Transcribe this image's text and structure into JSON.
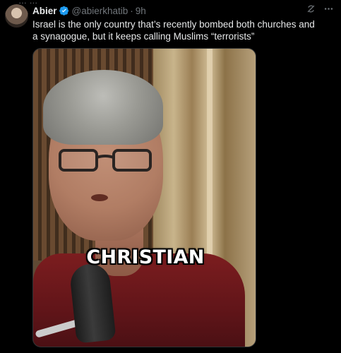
{
  "tweet": {
    "author_name": "Abier",
    "handle": "@abierkhatib",
    "separator": "·",
    "time": "9h",
    "text": "Israel is the only country that’s recently bombed both churches and a synagogue, but it keeps calling Muslims “terrorists”"
  },
  "media": {
    "caption": "CHRISTIAN"
  },
  "icons": {
    "verified": "verified-badge-icon",
    "grok": "grok-icon",
    "more": "more-icon"
  },
  "colors": {
    "background": "#000000",
    "text": "#e7e9ea",
    "secondary": "#71767b",
    "verified": "#1d9bf0"
  }
}
